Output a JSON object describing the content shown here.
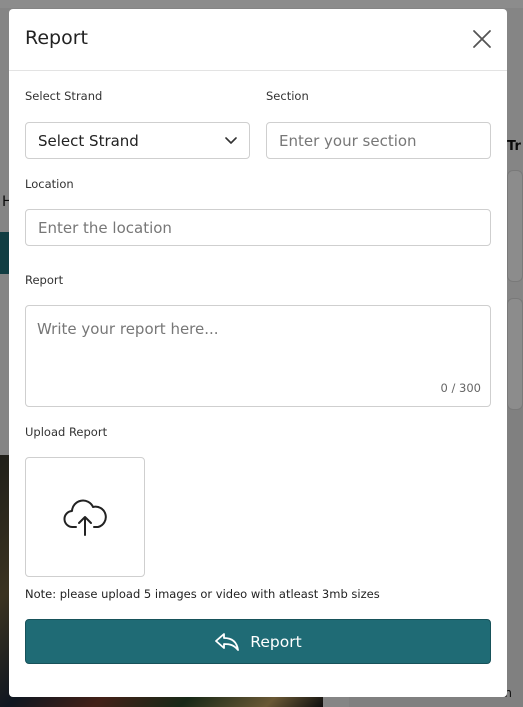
{
  "background": {
    "left_heading": "H",
    "right_label_top": "Tr",
    "right_label_bottom": "on"
  },
  "modal": {
    "title": "Report",
    "close_icon": "close-icon",
    "strand": {
      "label": "Select Strand",
      "selected": "Select Strand",
      "icon": "chevron-down-icon"
    },
    "section": {
      "label": "Section",
      "placeholder": "Enter your section"
    },
    "location": {
      "label": "Location",
      "placeholder": "Enter the location"
    },
    "report": {
      "label": "Report",
      "placeholder": "Write your report here...",
      "counter": "0 / 300"
    },
    "upload": {
      "label": "Upload Report",
      "icon": "cloud-upload-icon",
      "note": "Note: please upload 5 images or video with atleast 3mb sizes"
    },
    "submit": {
      "label": "Report",
      "icon": "reply-icon"
    }
  },
  "colors": {
    "accent": "#1f6b75",
    "overlay": "rgba(0,0,0,0.45)"
  }
}
